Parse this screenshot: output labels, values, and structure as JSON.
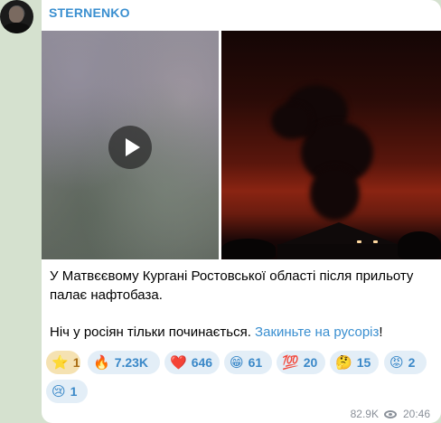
{
  "post": {
    "channel_name": "STERNENKO",
    "text_line1": "У Матвєєвому Кургані Ростовської області після прильоту",
    "text_line2": "палає нафтобаза.",
    "text_line3": "Ніч у росіян тільки починається.",
    "link_text": "Закиньте на русоріз",
    "text_end": "!"
  },
  "reactions": [
    {
      "emoji": "⭐",
      "count": "1",
      "name": "reaction-star"
    },
    {
      "emoji": "🔥",
      "count": "7.23K",
      "name": "reaction-fire"
    },
    {
      "emoji": "❤️",
      "count": "646",
      "name": "reaction-heart"
    },
    {
      "emoji": "😁",
      "count": "61",
      "name": "reaction-grin"
    },
    {
      "emoji": "💯",
      "count": "20",
      "name": "reaction-hundred"
    },
    {
      "emoji": "🤔",
      "count": "15",
      "name": "reaction-thinking"
    },
    {
      "emoji": "😡",
      "count": "2",
      "name": "reaction-angry"
    },
    {
      "emoji": "😢",
      "count": "1",
      "name": "reaction-crying"
    }
  ],
  "meta": {
    "views": "82.9K",
    "time": "20:46"
  },
  "icons": {
    "play": "play-icon",
    "views": "eye-icon"
  },
  "colors": {
    "accent": "#3a8fd0",
    "background": "#d5e1cf",
    "reaction_bg": "#e3eef7",
    "star_bg": "#f5e2b2"
  }
}
